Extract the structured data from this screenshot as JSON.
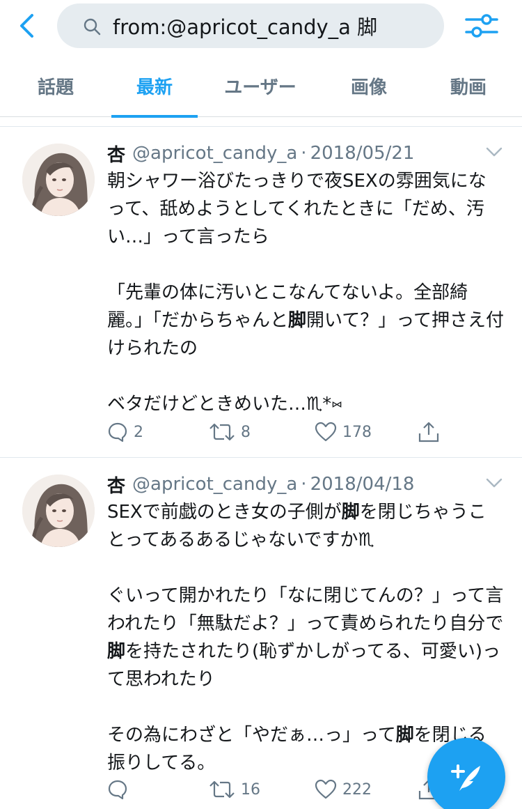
{
  "search": {
    "query": "from:@apricot_candy_a 脚"
  },
  "tabs": [
    {
      "label": "話題"
    },
    {
      "label": "最新"
    },
    {
      "label": "ユーザー"
    },
    {
      "label": "画像"
    },
    {
      "label": "動画"
    }
  ],
  "active_tab": "最新",
  "tweets": [
    {
      "name": "杏",
      "handle": "@apricot_candy_a",
      "date": "2018/05/21",
      "text_before_1": "朝シャワー浴びたっきりで夜SEXの雰囲気になって、舐めようとしてくれたときに「だめ、汚い…」って言ったら\n\n「先輩の体に汚いとこなんてないよ。全部綺麗。」「だからちゃんと",
      "highlight_1": "脚",
      "text_after_1": "開いて？」って押さえ付けられたの\n\nベタだけどときめいた…♏︎*⑅",
      "replies": "2",
      "retweets": "8",
      "likes": "178"
    },
    {
      "name": "杏",
      "handle": "@apricot_candy_a",
      "date": "2018/04/18",
      "text_p1_a": "SEXで前戯のとき女の子側が",
      "text_p1_hl": "脚",
      "text_p1_b": "を閉じちゃうことってあるあるじゃないですか♏︎\n\nぐいって開かれたり「なに閉じてんの？」って言われたり「無駄だよ？」って責められたり自分で",
      "text_p2_hl": "脚",
      "text_p2_b": "を持たされたり(恥ずかしがってる、可愛い)って思われたり\n\nその為にわざと「やだぁ…っ」って",
      "text_p3_hl": "脚",
      "text_p3_b": "を閉じる振りしてる。",
      "replies": "",
      "retweets": "16",
      "likes": "222"
    }
  ],
  "colors": {
    "accent": "#1da1f2",
    "secondary_text": "#657786",
    "primary_text": "#14171a",
    "search_bg": "#e6ecf0"
  },
  "icons": [
    "back-chevron-icon",
    "search-icon",
    "filter-sliders-icon",
    "caret-down-icon",
    "reply-icon",
    "retweet-icon",
    "like-heart-icon",
    "share-icon",
    "compose-feather-icon"
  ]
}
